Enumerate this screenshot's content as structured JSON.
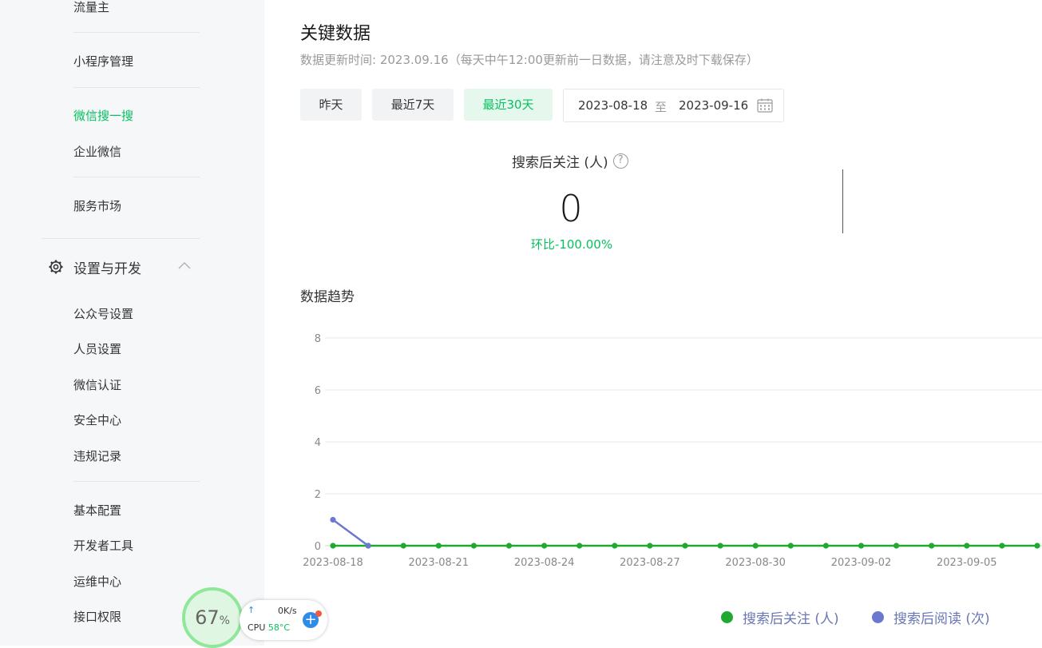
{
  "sidebar": {
    "items_top": [
      "流量主",
      "小程序管理",
      "微信搜一搜",
      "企业微信",
      "服务市场"
    ],
    "active_item": "微信搜一搜",
    "section": {
      "label": "设置与开发",
      "icon": "gear-icon",
      "expanded": true
    },
    "section_items": [
      "公众号设置",
      "人员设置",
      "微信认证",
      "安全中心",
      "违规记录",
      "基本配置",
      "开发者工具",
      "运维中心",
      "接口权限"
    ]
  },
  "main": {
    "title": "关键数据",
    "subtitle": "数据更新时间: 2023.09.16（每天中午12:00更新前一日数据，请注意及时下载保存）",
    "range_buttons": [
      "昨天",
      "最近7天",
      "最近30天"
    ],
    "active_range": "最近30天",
    "date_range": {
      "start": "2023-08-18",
      "separator": "至",
      "end": "2023-09-16"
    },
    "kpi": {
      "label": "搜索后关注 (人)",
      "help": "?",
      "value": "0",
      "ratio": "环比-100.00%"
    },
    "trend_title": "数据趋势"
  },
  "chart_data": {
    "type": "line",
    "x": [
      "2023-08-18",
      "2023-08-19",
      "2023-08-20",
      "2023-08-21",
      "2023-08-22",
      "2023-08-23",
      "2023-08-24",
      "2023-08-25",
      "2023-08-26",
      "2023-08-27",
      "2023-08-28",
      "2023-08-29",
      "2023-08-30",
      "2023-08-31",
      "2023-09-01",
      "2023-09-02",
      "2023-09-03",
      "2023-09-04",
      "2023-09-05",
      "2023-09-06",
      "2023-09-07"
    ],
    "xtick_labels": [
      "2023-08-18",
      "2023-08-21",
      "2023-08-24",
      "2023-08-27",
      "2023-08-30",
      "2023-09-02",
      "2023-09-05"
    ],
    "yticks": [
      0,
      2,
      4,
      6,
      8
    ],
    "ylim": [
      0,
      8
    ],
    "grid": true,
    "legend_position": "bottom-right",
    "series": [
      {
        "name": "搜索后关注 (人)",
        "color": "#20a930",
        "values": [
          0,
          0,
          0,
          0,
          0,
          0,
          0,
          0,
          0,
          0,
          0,
          0,
          0,
          0,
          0,
          0,
          0,
          0,
          0,
          0,
          0
        ]
      },
      {
        "name": "搜索后阅读 (次)",
        "color": "#6b78d2",
        "values": [
          1,
          0
        ]
      }
    ]
  },
  "widget": {
    "percent": "67",
    "percent_unit": "%",
    "net_speed": "0K/s",
    "cpu_label": "CPU",
    "cpu_temp": "58°C"
  }
}
